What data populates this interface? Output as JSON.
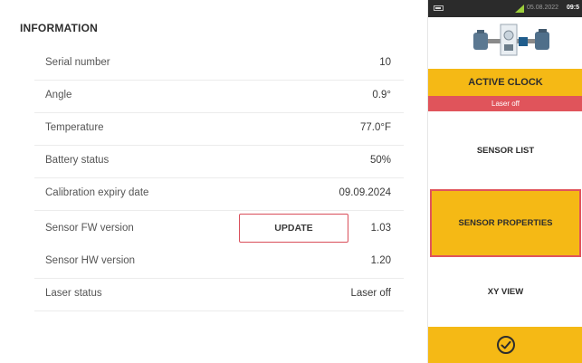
{
  "section_title": "INFORMATION",
  "rows": [
    {
      "label": "Serial number",
      "value": "10"
    },
    {
      "label": "Angle",
      "value": "0.9°"
    },
    {
      "label": "Temperature",
      "value": "77.0°F"
    },
    {
      "label": "Battery status",
      "value": "50%"
    },
    {
      "label": "Calibration expiry date",
      "value": "09.09.2024"
    },
    {
      "label": "Sensor FW version",
      "value": "1.03",
      "button": "UPDATE"
    },
    {
      "label": "Sensor HW version",
      "value": "1.20"
    },
    {
      "label": "Laser status",
      "value": "Laser off"
    }
  ],
  "statusbar": {
    "date": "05.08.2022",
    "time": "09:5"
  },
  "side": {
    "active_clock": "ACTIVE CLOCK",
    "laser_status": "Laser off",
    "sensor_list": "SENSOR LIST",
    "sensor_properties": "SENSOR PROPERTIES",
    "xy_view": "XY VIEW",
    "confirm_icon": "check-circle-icon"
  },
  "colors": {
    "accent": "#f5b915",
    "alert": "#e0545b"
  }
}
